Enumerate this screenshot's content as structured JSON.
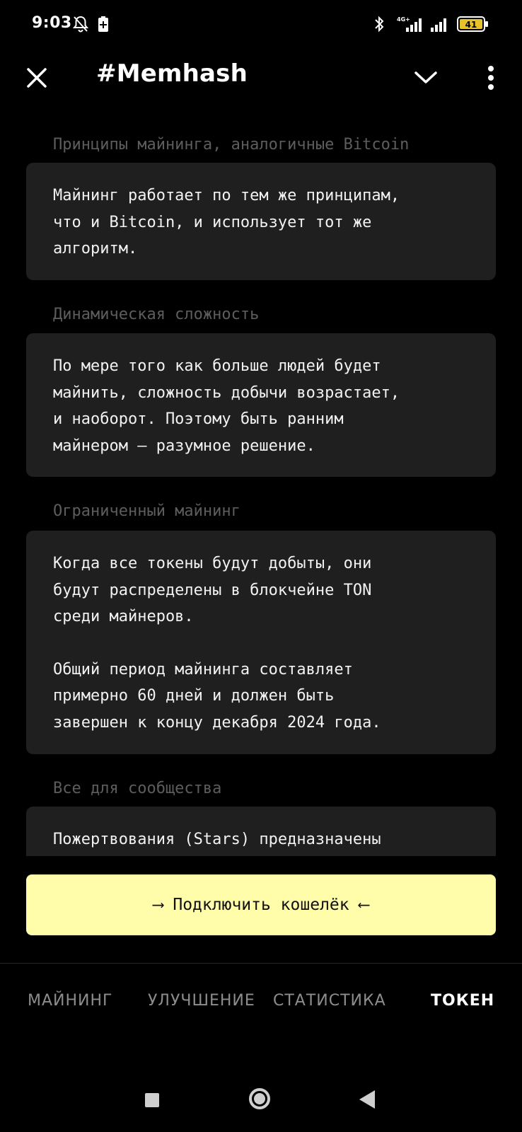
{
  "status_bar": {
    "time": "9:03",
    "network_label": "4G+",
    "battery_level": "41"
  },
  "header": {
    "title": "#Memhash"
  },
  "sections": [
    {
      "title": "Принципы майнинга, аналогичные Bitcoin",
      "paragraphs": [
        "Майнинг работает по тем же принципам,\nчто и Bitcoin, и использует тот же\nалгоритм."
      ]
    },
    {
      "title": "Динамическая сложность",
      "paragraphs": [
        "По мере того как больше людей будет\nмайнить, сложность добычи возрастает,\nи наоборот. Поэтому быть ранним\nмайнером — разумное решение."
      ]
    },
    {
      "title": "Ограниченный майнинг",
      "paragraphs": [
        "Когда все токены будут добыты, они\nбудут распределены в блокчейне TON\nсреди майнеров.",
        "Общий период майнинга составляет\nпримерно 60 дней и должен быть\nзавершен к концу декабря 2024 года."
      ]
    },
    {
      "title": "Все для сообщества",
      "paragraphs": [
        "Пожертвования (Stars) предназначены"
      ]
    }
  ],
  "cta": {
    "label": "⟶ Подключить кошелёк ⟵"
  },
  "tabs": [
    {
      "label": "МАЙНИНГ",
      "active": false
    },
    {
      "label": "УЛУЧШЕНИЕ",
      "active": false
    },
    {
      "label": "СТАТИСТИКА",
      "active": false
    },
    {
      "label": "ТОКЕН",
      "active": true
    }
  ],
  "icons": {
    "close": "close-icon",
    "chevron": "chevron-down-icon",
    "menu": "more-vertical-icon"
  }
}
